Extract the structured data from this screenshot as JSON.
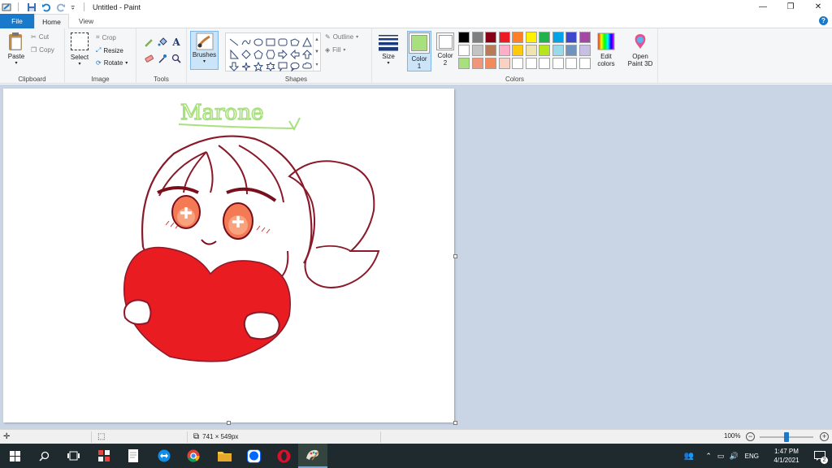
{
  "window": {
    "title": "Untitled - Paint",
    "controls": {
      "minimize": "—",
      "restore": "❐",
      "close": "✕"
    }
  },
  "tabs": {
    "file": "File",
    "home": "Home",
    "view": "View",
    "help": "?"
  },
  "ribbon": {
    "clipboard": {
      "paste": "Paste",
      "cut": "Cut",
      "copy": "Copy",
      "group": "Clipboard"
    },
    "image": {
      "select": "Select",
      "crop": "Crop",
      "resize": "Resize",
      "rotate": "Rotate",
      "group": "Image"
    },
    "tools": {
      "group": "Tools"
    },
    "brushes": {
      "label": "Brushes"
    },
    "shapes": {
      "outline": "Outline",
      "fill": "Fill",
      "group": "Shapes"
    },
    "size": {
      "label": "Size"
    },
    "colors": {
      "color1_label": "Color",
      "color1_num": "1",
      "color2_label": "Color",
      "color2_num": "2",
      "color1_value": "#a8e07e",
      "color2_value": "#ffffff",
      "edit_label": "Edit",
      "edit_label2": "colors",
      "paint3d_label": "Open",
      "paint3d_label2": "Paint 3D",
      "group": "Colors",
      "palette": [
        "#000000",
        "#7f7f7f",
        "#880015",
        "#ed1c24",
        "#ff7f27",
        "#fff200",
        "#22b14c",
        "#00a2e8",
        "#3f48cc",
        "#a349a4",
        "#ffffff",
        "#c3c3c3",
        "#b97a57",
        "#ffaec9",
        "#ffc90e",
        "#efe4b0",
        "#b5e61d",
        "#99d9ea",
        "#7092be",
        "#c8bfe7",
        "#a8e07e",
        "#f0967a",
        "#f28a5c",
        "#fbd1c4",
        "#ffffff",
        "#ffffff",
        "#ffffff",
        "#ffffff",
        "#ffffff",
        "#ffffff"
      ]
    }
  },
  "canvas": {
    "signature_text": "Marone"
  },
  "statusbar": {
    "image_size": "741 × 549px",
    "zoom": "100%",
    "zoom_minus": "−",
    "zoom_plus": "+"
  },
  "taskbar": {
    "time": "1:47 PM",
    "date": "4/1/2021",
    "lang": "ENG",
    "notifications": "2"
  }
}
